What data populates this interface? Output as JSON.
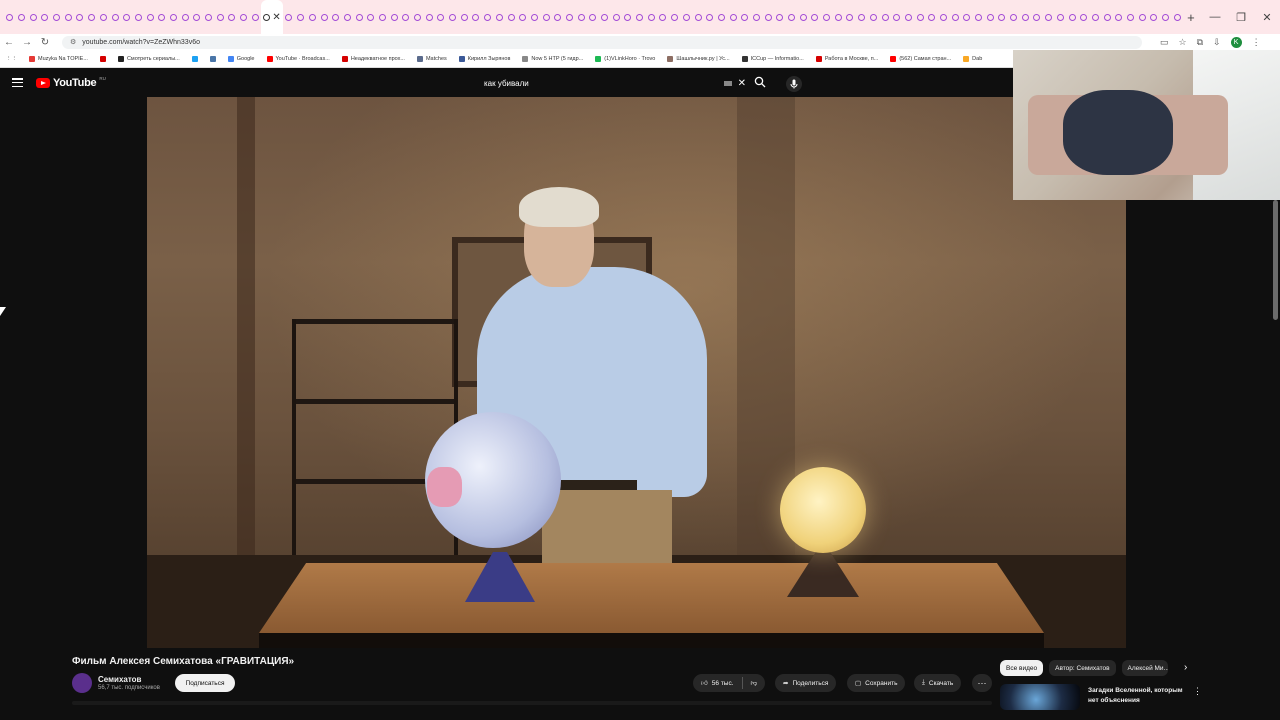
{
  "browser": {
    "url": "youtube.com/watch?v=ZeZWhn33v6o",
    "tab_count": 100,
    "bookmarks": [
      {
        "label": "Muzyka Na TOPIE...",
        "color": "#e53935"
      },
      {
        "label": "",
        "color": "#d50000"
      },
      {
        "label": "Смотреть сериалы...",
        "color": "#222222"
      },
      {
        "label": "",
        "color": "#1da1f2"
      },
      {
        "label": "",
        "color": "#4a76a8"
      },
      {
        "label": "Google",
        "color": "#4285f4"
      },
      {
        "label": "YouTube · Broadcas...",
        "color": "#ff0000"
      },
      {
        "label": "Неадекватное прох...",
        "color": "#d50000"
      },
      {
        "label": "Matches",
        "color": "#5b6b8c"
      },
      {
        "label": "Кирилл Зырянов",
        "color": "#3b5998"
      },
      {
        "label": "Now 5 HTP (5 гидр...",
        "color": "#888888"
      },
      {
        "label": "(1)VLinkHoro · Trovo",
        "color": "#1db954"
      },
      {
        "label": "Шашлычник.ру | Ус...",
        "color": "#8d6e63"
      },
      {
        "label": "ICCup — Informatio...",
        "color": "#333333"
      },
      {
        "label": "Работа в Москве, п...",
        "color": "#d50000"
      },
      {
        "label": "(562) Самая стран...",
        "color": "#ff0000"
      },
      {
        "label": "Dab",
        "color": "#f9a825"
      }
    ]
  },
  "youtube": {
    "logo_text": "YouTube",
    "region": "RU",
    "search_query": "как убивали"
  },
  "video": {
    "title": "Фильм Алексея Семихатова «ГРАВИТАЦИЯ»",
    "channel": "Семихатов",
    "subscribers": "56,7 тыс. подписчиков",
    "subscribe_label": "Подписаться",
    "likes": "56 тыс.",
    "share_label": "Поделиться",
    "save_label": "Сохранить",
    "download_label": "Скачать"
  },
  "sidebar": {
    "chips": [
      "Все видео",
      "Автор: Семихатов",
      "Алексей Ми..."
    ],
    "recommendation_title": "Загадки Вселенной, которым нет объяснения"
  }
}
